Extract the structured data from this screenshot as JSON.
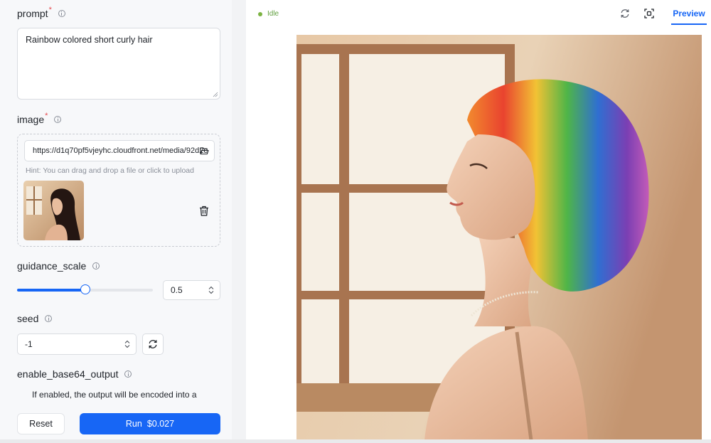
{
  "form": {
    "prompt": {
      "label": "prompt",
      "required_mark": "*",
      "value": "Rainbow colored short curly hair"
    },
    "image": {
      "label": "image",
      "required_mark": "*",
      "url": "https://d1q70pf5vjeyhc.cloudfront.net/media/92d2c",
      "hint": "Hint: You can drag and drop a file or click to upload"
    },
    "guidance_scale": {
      "label": "guidance_scale",
      "value": "0.5",
      "slider_fraction": 0.5
    },
    "seed": {
      "label": "seed",
      "value": "-1"
    },
    "enable_base64_output": {
      "label": "enable_base64_output",
      "description": "If enabled, the output will be encoded into a"
    }
  },
  "actions": {
    "reset_label": "Reset",
    "run_label": "Run",
    "run_price": "$0.027"
  },
  "output": {
    "status": "Idle",
    "tab_preview": "Preview"
  },
  "colors": {
    "accent": "#1766f5",
    "status_idle": "#7cb342",
    "required": "#e5484d"
  }
}
